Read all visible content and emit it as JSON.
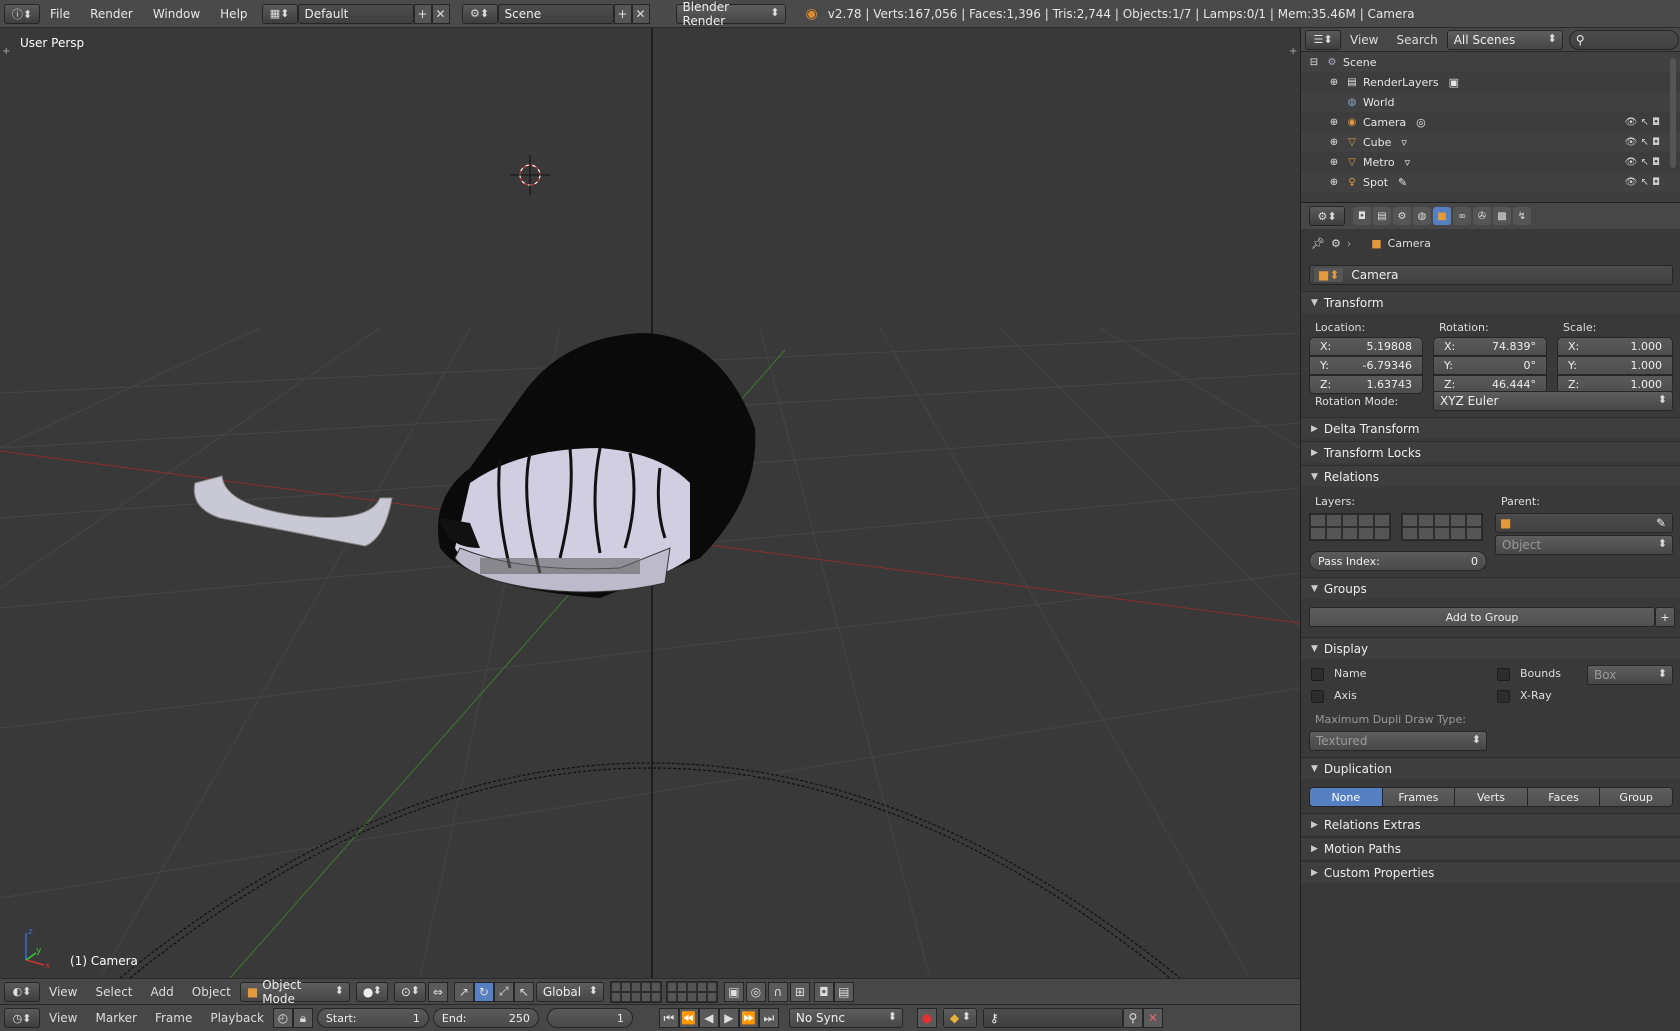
{
  "topbar": {
    "menus": [
      "File",
      "Render",
      "Window",
      "Help"
    ],
    "layout": "Default",
    "scene": "Scene",
    "engine": "Blender Render",
    "stats": "v2.78 | Verts:167,056 | Faces:1,396 | Tris:2,744 | Objects:1/7 | Lamps:0/1 | Mem:35.46M | Camera"
  },
  "viewport": {
    "view_label": "User Persp",
    "object_label": "(1) Camera"
  },
  "header3d": {
    "items": [
      "View",
      "Select",
      "Add",
      "Object"
    ],
    "mode": "Object Mode",
    "orientation": "Global"
  },
  "timeline": {
    "items": [
      "View",
      "Marker",
      "Frame",
      "Playback"
    ],
    "start_label": "Start:",
    "start": "1",
    "end_label": "End:",
    "end": "250",
    "current": "1",
    "sync": "No Sync"
  },
  "outliner": {
    "menus": [
      "View",
      "Search"
    ],
    "filter": "All Scenes",
    "rows": [
      {
        "label": "Scene",
        "icon": "scene-icon"
      },
      {
        "label": "RenderLayers",
        "icon": "renderlayers-icon"
      },
      {
        "label": "World",
        "icon": "world-icon"
      },
      {
        "label": "Camera",
        "icon": "camera-icon"
      },
      {
        "label": "Cube",
        "icon": "mesh-icon"
      },
      {
        "label": "Metro",
        "icon": "mesh-icon"
      },
      {
        "label": "Spot",
        "icon": "lamp-icon"
      }
    ]
  },
  "properties": {
    "breadcrumb": "Camera",
    "object_name": "Camera",
    "transform": {
      "title": "Transform",
      "location_label": "Location:",
      "rotation_label": "Rotation:",
      "scale_label": "Scale:",
      "location": {
        "x": "5.19808",
        "y": "-6.79346",
        "z": "1.63743"
      },
      "rotation": {
        "x": "74.839°",
        "y": "0°",
        "z": "46.444°"
      },
      "scale": {
        "x": "1.000",
        "y": "1.000",
        "z": "1.000"
      },
      "rotation_mode_label": "Rotation Mode:",
      "rotation_mode": "XYZ Euler"
    },
    "delta_transform": "Delta Transform",
    "transform_locks": "Transform Locks",
    "relations": {
      "title": "Relations",
      "layers_label": "Layers:",
      "parent_label": "Parent:",
      "parent_type": "Object",
      "pass_index_label": "Pass Index:",
      "pass_index": "0"
    },
    "groups": {
      "title": "Groups",
      "add_label": "Add to Group"
    },
    "display": {
      "title": "Display",
      "name": "Name",
      "axis": "Axis",
      "bounds": "Bounds",
      "xray": "X-Ray",
      "bounds_type": "Box",
      "dupli_label": "Maximum Dupli Draw Type:",
      "dupli_type": "Textured"
    },
    "duplication": {
      "title": "Duplication",
      "options": [
        "None",
        "Frames",
        "Verts",
        "Faces",
        "Group"
      ]
    },
    "relations_extras": "Relations Extras",
    "motion_paths": "Motion Paths",
    "custom_properties": "Custom Properties"
  }
}
